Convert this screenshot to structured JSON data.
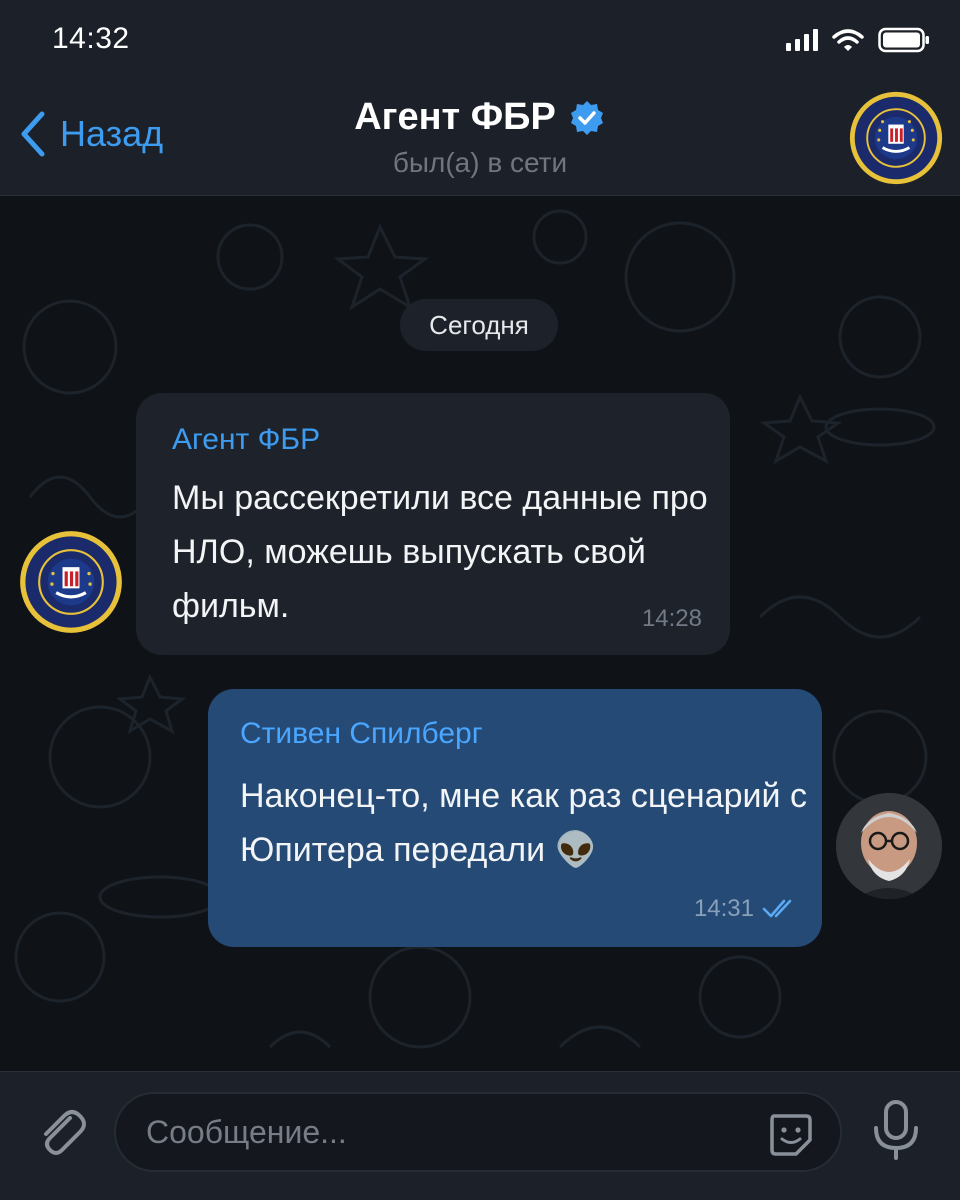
{
  "status_bar": {
    "time": "14:32",
    "icons": [
      "signal-icon",
      "wifi-icon",
      "battery-icon"
    ]
  },
  "header": {
    "back_label": "Назад",
    "title": "Агент ФБР",
    "verified_icon": "verified-badge-icon",
    "status": "был(а) в сети"
  },
  "chat": {
    "date_label": "Сегодня",
    "messages": [
      {
        "direction": "incoming",
        "sender": "Агент ФБР",
        "text": "Мы рассекретили все данные про НЛО, можешь выпускать свой фильм.",
        "time": "14:28"
      },
      {
        "direction": "outgoing",
        "sender": "Стивен Спилберг",
        "text": "Наконец-то, мне как раз сценарий с Юпитера передали 👽",
        "time": "14:31",
        "read_status": "double-check-icon"
      }
    ]
  },
  "input_bar": {
    "placeholder": "Сообщение...",
    "icons": [
      "paperclip-icon",
      "sticker-icon",
      "microphone-icon"
    ]
  },
  "colors": {
    "accent": "#3e9cf0",
    "header_bg": "#1c2129",
    "incoming_bubble": "#1e232b",
    "outgoing_bubble": "#244a75",
    "chat_bg": "#0f1318"
  }
}
